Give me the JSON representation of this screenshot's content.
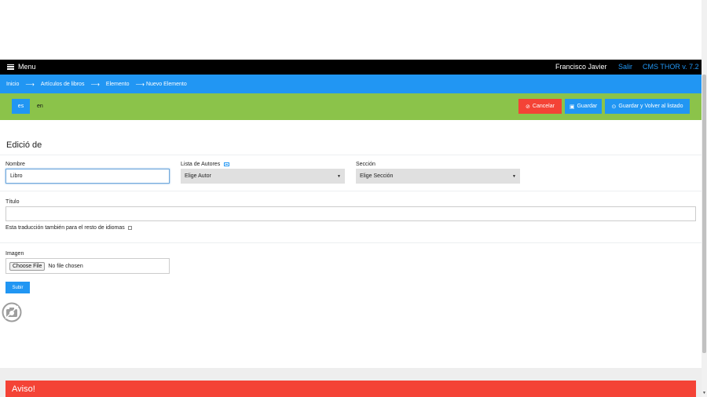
{
  "topbar": {
    "menu_label": "Menu",
    "user_name": "Francisco Javier",
    "logout_label": "Salir",
    "cms_version": "CMS THOR v. 7.2",
    "link_color": "#2196f3"
  },
  "breadcrumb": {
    "items": [
      "Inicio",
      "Artículos de libros",
      "Elemento",
      "Nuevo Elemento"
    ],
    "separator": "⟶"
  },
  "languages": {
    "items": [
      "es",
      "en"
    ],
    "active": "es"
  },
  "actions": {
    "cancel_label": "Cancelar",
    "save_label": "Guardar",
    "save_back_label": "Guardar y Volver al listado"
  },
  "form": {
    "title": "Edició de",
    "nombre": {
      "label": "Nombre",
      "value": "Libro"
    },
    "autores": {
      "label": "Lista de Autores",
      "selected": "Elige Autor"
    },
    "seccion": {
      "label": "Sección",
      "selected": "Elige Sección"
    },
    "titulo": {
      "label": "Título",
      "value": ""
    },
    "translate_all": {
      "label": "Esta traducción también para el resto de idiomas",
      "checked": false
    },
    "imagen": {
      "label": "Imagen",
      "button_label": "Choose File",
      "status": "No file chosen"
    },
    "upload_label": "Subir"
  },
  "alert": {
    "title": "Aviso!",
    "color": "#f44336"
  },
  "colors": {
    "primary": "#2196f3",
    "success": "#8bc34a",
    "danger": "#f44336",
    "dark": "#000000"
  },
  "icons": {
    "menu": "hamburger-icon",
    "cancel": "cancel-circle-icon",
    "save": "floppy-icon",
    "save_back": "arrow-circle-icon",
    "list": "list-icon",
    "image_placeholder": "camera-icon"
  }
}
